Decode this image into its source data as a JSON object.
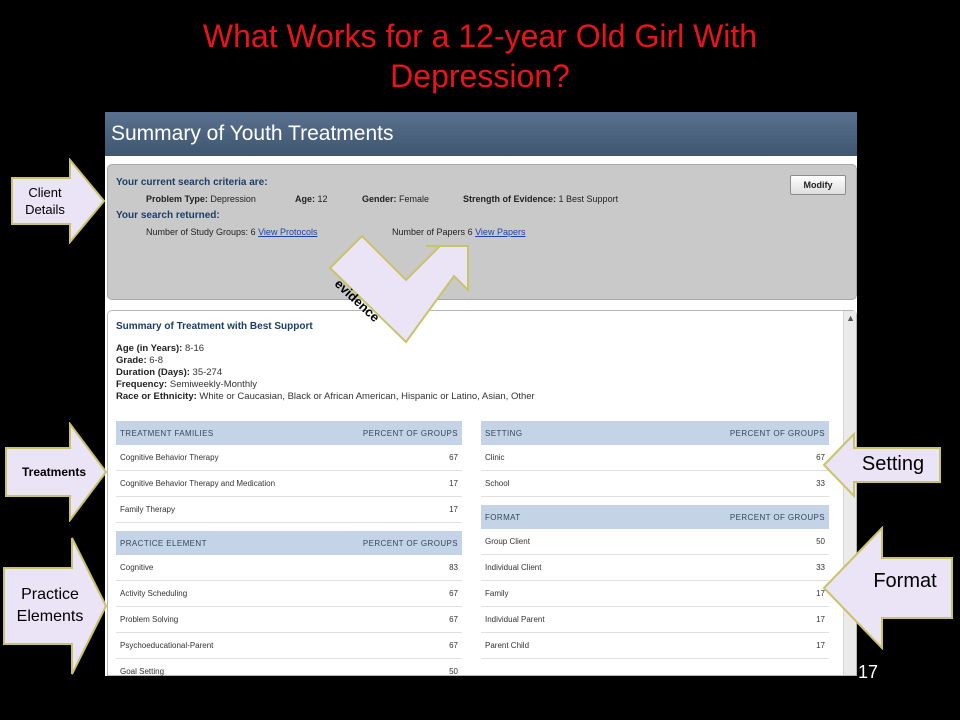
{
  "slide": {
    "title_line1": "What Works for a 12-year Old Girl With",
    "title_line2": "Depression?",
    "page_number": "17"
  },
  "app": {
    "title": "Summary of Youth Treatments"
  },
  "criteria": {
    "heading": "Your current search criteria are:",
    "problem_type_label": "Problem Type:",
    "problem_type_value": "Depression",
    "age_label": "Age:",
    "age_value": "12",
    "gender_label": "Gender:",
    "gender_value": "Female",
    "evidence_label": "Strength of Evidence:",
    "evidence_value": "1 Best Support",
    "modify_button": "Modify",
    "returned_heading": "Your search returned:",
    "study_groups_label": "Number of Study Groups:",
    "study_groups_value": "6",
    "view_protocols": "View Protocols",
    "papers_label": "Number of Papers",
    "papers_value": "6",
    "view_papers": "View Papers"
  },
  "summary": {
    "title": "Summary of Treatment with Best Support",
    "age_label": "Age (in Years):",
    "age_value": "8-16",
    "grade_label": "Grade:",
    "grade_value": "6-8",
    "duration_label": "Duration (Days):",
    "duration_value": "35-274",
    "frequency_label": "Frequency:",
    "frequency_value": "Semiweekly-Monthly",
    "race_label": "Race or Ethnicity:",
    "race_value": "White or Caucasian, Black or African American, Hispanic or Latino, Asian, Other"
  },
  "treatment_families": {
    "header": "TREATMENT FAMILIES",
    "pct_header": "PERCENT OF GROUPS",
    "rows": [
      {
        "name": "Cognitive Behavior Therapy",
        "pct": "67"
      },
      {
        "name": "Cognitive Behavior Therapy and Medication",
        "pct": "17"
      },
      {
        "name": "Family Therapy",
        "pct": "17"
      }
    ]
  },
  "practice_elements": {
    "header": "PRACTICE ELEMENT",
    "pct_header": "PERCENT OF GROUPS",
    "rows": [
      {
        "name": "Cognitive",
        "pct": "83"
      },
      {
        "name": "Activity Scheduling",
        "pct": "67"
      },
      {
        "name": "Problem Solving",
        "pct": "67"
      },
      {
        "name": "Psychoeducational-Parent",
        "pct": "67"
      },
      {
        "name": "Goal Setting",
        "pct": "50"
      }
    ]
  },
  "setting": {
    "header": "SETTING",
    "pct_header": "PERCENT OF GROUPS",
    "rows": [
      {
        "name": "Clinic",
        "pct": "67"
      },
      {
        "name": "School",
        "pct": "33"
      }
    ]
  },
  "format": {
    "header": "FORMAT",
    "pct_header": "PERCENT OF GROUPS",
    "rows": [
      {
        "name": "Group Client",
        "pct": "50"
      },
      {
        "name": "Individual Client",
        "pct": "33"
      },
      {
        "name": "Family",
        "pct": "17"
      },
      {
        "name": "Individual Parent",
        "pct": "17"
      },
      {
        "name": "Parent Child",
        "pct": "17"
      }
    ]
  },
  "callouts": {
    "client_details_1": "Client",
    "client_details_2": "Details",
    "evidence": "evidence",
    "treatments": "Treatments",
    "practice_1": "Practice",
    "practice_2": "Elements",
    "setting": "Setting",
    "format": "Format"
  },
  "colors": {
    "title_red": "#e8141b",
    "callout_fill": "#ebe3f6",
    "callout_stroke": "#c9c36a",
    "table_header": "#c4d4e6"
  }
}
